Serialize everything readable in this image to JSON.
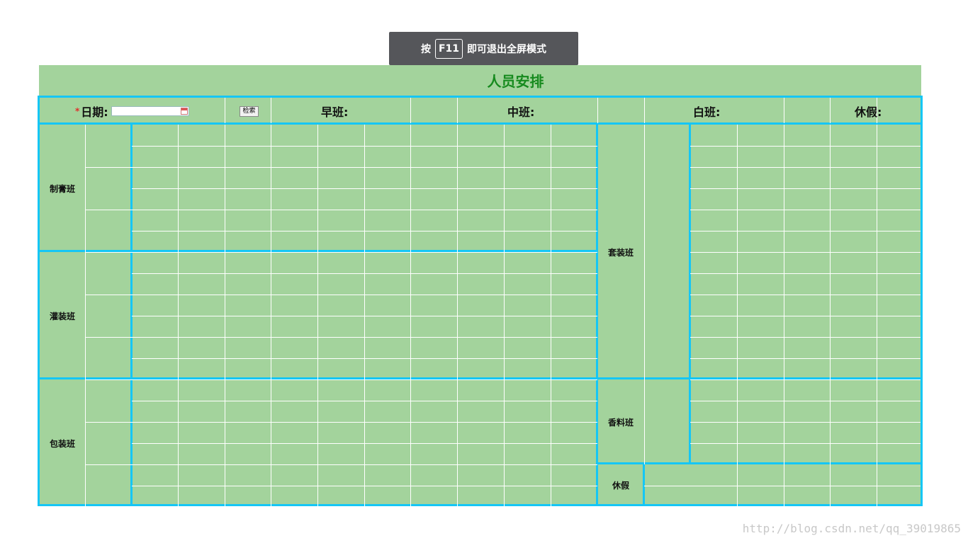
{
  "toast": {
    "prefix": "按",
    "key": "F11",
    "suffix": "即可退出全屏模式"
  },
  "page": {
    "title": "人员安排"
  },
  "header": {
    "required_mark": "*",
    "date_label": "日期:",
    "date_value": "",
    "search_label": "检索",
    "morning_label": "早班:",
    "middle_label": "中班:",
    "day_label": "白班:",
    "holiday_label": "休假:"
  },
  "groups": {
    "paste": "制膏班",
    "filling": "灌装班",
    "packing": "包装班",
    "kit": "套装班",
    "spice": "香料班",
    "holiday": "休假"
  },
  "watermark": "http://blog.csdn.net/qq_39019865",
  "colors": {
    "cell_bg": "#a3d39c",
    "border": "#15c6f5",
    "title": "#168a1e"
  }
}
